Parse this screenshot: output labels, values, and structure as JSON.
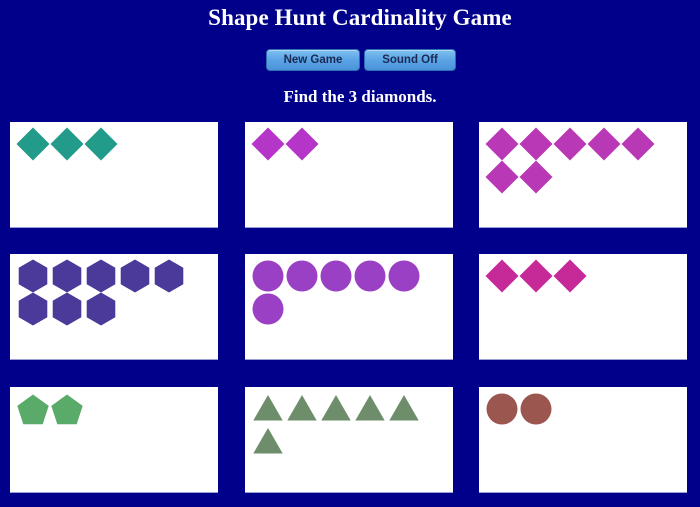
{
  "header": {
    "title": "Shape Hunt Cardinality Game"
  },
  "toolbar": {
    "new_game_label": "New Game",
    "sound_label": "Sound Off"
  },
  "prompt": {
    "text": "Find the 3 diamonds.",
    "target_count": 3,
    "target_shape": "diamond"
  },
  "cards": [
    {
      "shape": "diamond",
      "count": 3,
      "color": "#239b8a"
    },
    {
      "shape": "diamond",
      "count": 2,
      "color": "#b535c8"
    },
    {
      "shape": "diamond",
      "count": 7,
      "color": "#b938b5"
    },
    {
      "shape": "hexagon",
      "count": 8,
      "color": "#4b3a9a"
    },
    {
      "shape": "circle",
      "count": 6,
      "color": "#9a40c4"
    },
    {
      "shape": "diamond",
      "count": 3,
      "color": "#c62a98"
    },
    {
      "shape": "pentagon",
      "count": 2,
      "color": "#5aab6a"
    },
    {
      "shape": "triangle",
      "count": 6,
      "color": "#6e8d6a"
    },
    {
      "shape": "circle",
      "count": 2,
      "color": "#9a564f"
    }
  ]
}
